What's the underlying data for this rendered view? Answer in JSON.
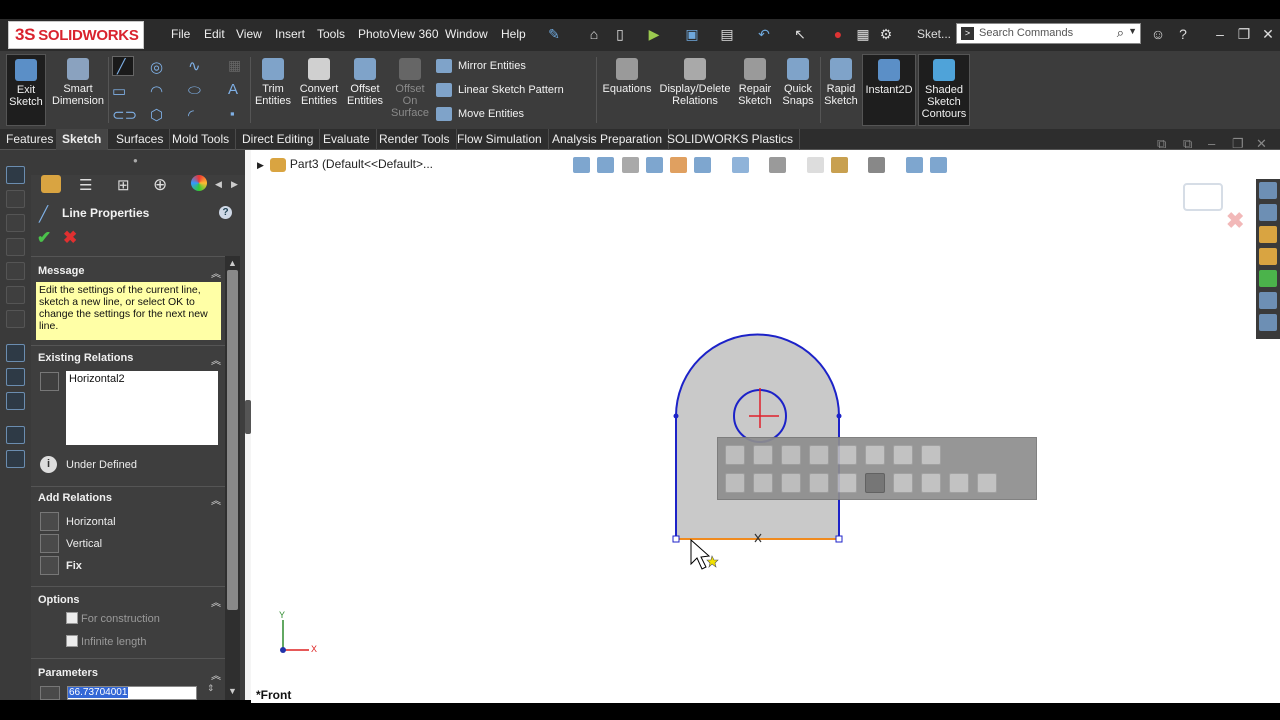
{
  "app": {
    "brand_prefix": "3S",
    "brand_name": "SOLIDWORKS",
    "sketch_short": "Sket..."
  },
  "menu": [
    "File",
    "Edit",
    "View",
    "Insert",
    "Tools",
    "PhotoView 360",
    "Window",
    "Help"
  ],
  "search": {
    "placeholder": "Search Commands"
  },
  "command_manager": {
    "exit_sketch": "Exit Sketch",
    "smart_dimension": "Smart Dimension",
    "trim_entities": "Trim Entities",
    "convert_entities": "Convert Entities",
    "offset_entities": "Offset Entities",
    "offset_on_surface": "Offset On Surface",
    "mirror_entities": "Mirror Entities",
    "linear_sketch_pattern": "Linear Sketch Pattern",
    "move_entities": "Move Entities",
    "equations": "Equations",
    "display_delete_relations": "Display/Delete Relations",
    "repair_sketch": "Repair Sketch",
    "quick_snaps": "Quick Snaps",
    "rapid_sketch": "Rapid Sketch",
    "instant2d": "Instant2D",
    "shaded_sketch_contours": "Shaded Sketch Contours"
  },
  "tabs": [
    "Features",
    "Sketch",
    "Surfaces",
    "Mold Tools",
    "Direct Editing",
    "Evaluate",
    "Render Tools",
    "Flow Simulation",
    "Analysis Preparation",
    "SOLIDWORKS Plastics"
  ],
  "active_tab": "Sketch",
  "property_manager": {
    "title": "Line Properties",
    "help": "?",
    "message_header": "Message",
    "message_text": "Edit the settings of the current line, sketch a new line, or select OK to change the settings for the next new line.",
    "existing_relations_header": "Existing Relations",
    "existing_relations": [
      "Horizontal2"
    ],
    "status": "Under Defined",
    "add_relations_header": "Add Relations",
    "add_relations": [
      "Horizontal",
      "Vertical",
      "Fix"
    ],
    "options_header": "Options",
    "options": [
      "For construction",
      "Infinite length"
    ],
    "parameters_header": "Parameters",
    "length_value": "66.73704001"
  },
  "viewport": {
    "tree_label": "Part3  (Default<<Default>...",
    "view_name": "*Front",
    "axis_y": "Y",
    "axis_x": "X"
  },
  "colors": {
    "sketch_blue": "#1c22c8",
    "selected_line": "#f08a1e",
    "fill": "#c9c9c9",
    "origin_red": "#e0202a"
  }
}
